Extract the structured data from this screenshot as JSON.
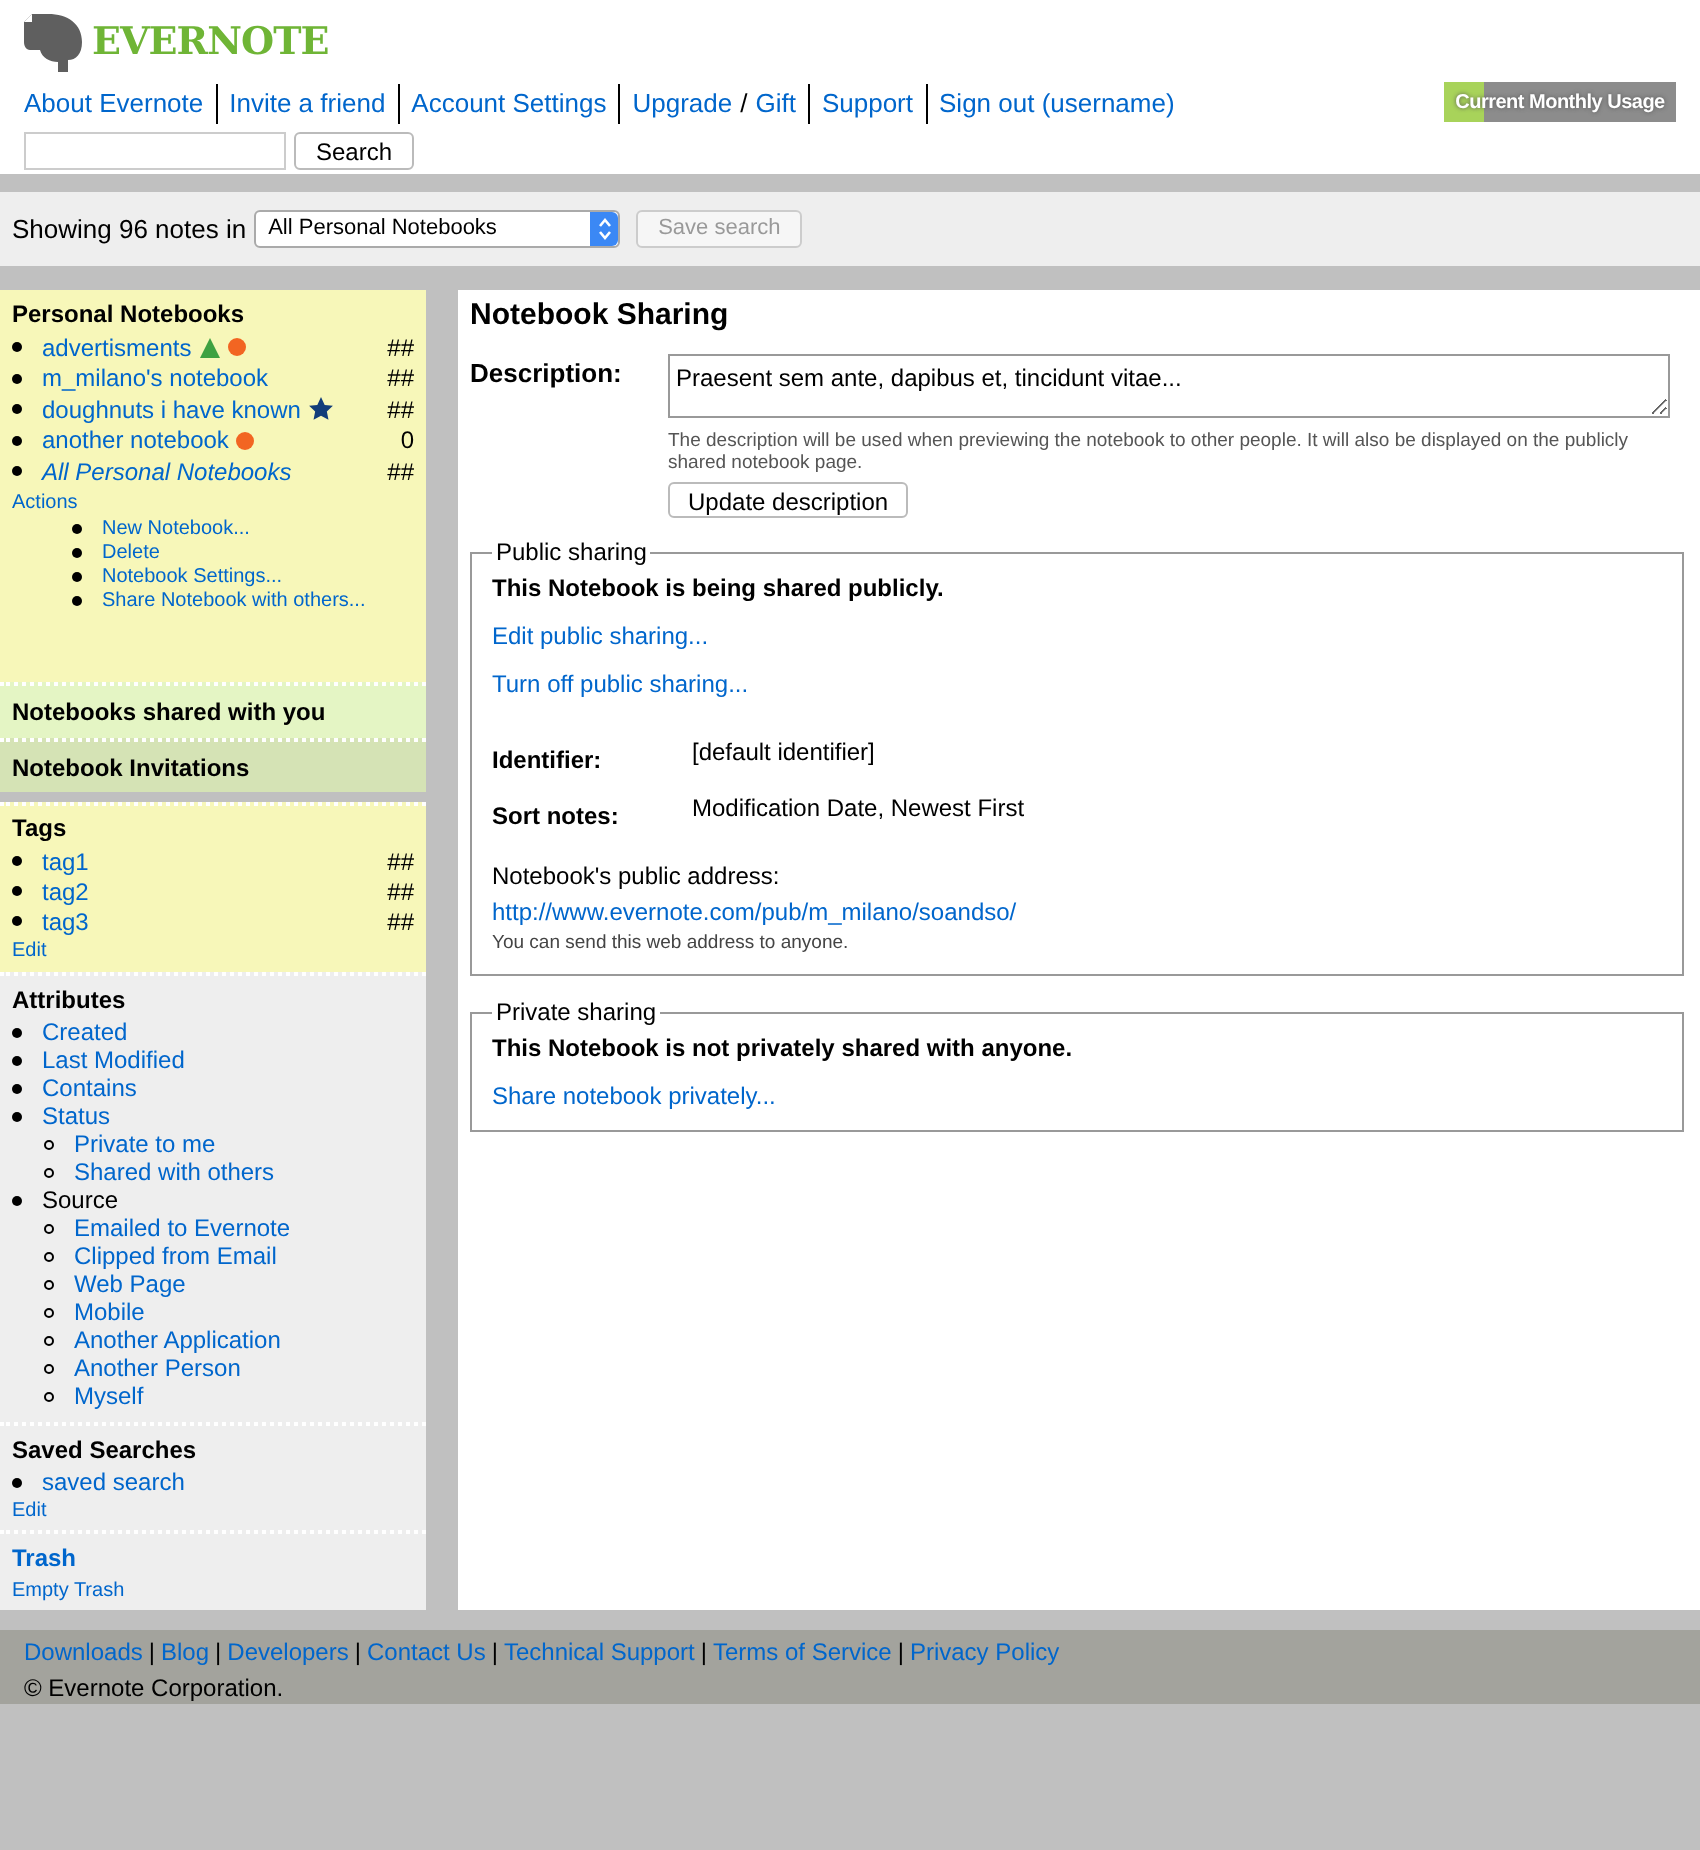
{
  "header": {
    "logo": "EVERNOTE",
    "nav": [
      "About Evernote",
      "Invite a friend",
      "Account Settings",
      "Upgrade",
      "Gift",
      "Support",
      "Sign out (username)"
    ],
    "upgrade_separator": "/",
    "search_button": "Search",
    "usage": {
      "label": "Current Monthly Usage",
      "level": 0.17
    }
  },
  "toolbar": {
    "showing": "Showing 96 notes in",
    "notebook_select": "All Personal Notebooks",
    "save_button": "Save search",
    "save_disabled": true
  },
  "sidebar": {
    "notebooks": {
      "title": "Personal Notebooks",
      "items": [
        {
          "name": "advertisments",
          "count": "##",
          "triangle": true,
          "dot": true,
          "star": false,
          "italic": false
        },
        {
          "name": "m_milano's notebook",
          "count": "##",
          "triangle": false,
          "dot": false,
          "star": false,
          "italic": false
        },
        {
          "name": "doughnuts i have known",
          "count": "##",
          "triangle": false,
          "dot": false,
          "star": true,
          "italic": false
        },
        {
          "name": "another notebook",
          "count": "0",
          "triangle": false,
          "dot": true,
          "star": false,
          "italic": false
        },
        {
          "name": "All Personal Notebooks",
          "count": "##",
          "triangle": false,
          "dot": false,
          "star": false,
          "italic": true
        }
      ],
      "actions_label": "Actions",
      "actions": [
        "New Notebook...",
        "Delete",
        "Notebook Settings...",
        "Share Notebook with others..."
      ]
    },
    "shared_title": "Notebooks shared with you",
    "invitations_title": "Notebook Invitations",
    "tags": {
      "title": "Tags",
      "items": [
        {
          "name": "tag1",
          "count": "##"
        },
        {
          "name": "tag2",
          "count": "##"
        },
        {
          "name": "tag3",
          "count": "##"
        }
      ],
      "edit": "Edit"
    },
    "attributes": {
      "title": "Attributes",
      "items": [
        {
          "label": "Created",
          "link": true
        },
        {
          "label": "Last Modified",
          "link": true
        },
        {
          "label": "Contains",
          "link": true
        },
        {
          "label": "Status",
          "link": true,
          "children": [
            {
              "label": "Private to me"
            },
            {
              "label": "Shared with others"
            }
          ]
        },
        {
          "label": "Source",
          "link": false,
          "children": [
            {
              "label": "Emailed to Evernote"
            },
            {
              "label": "Clipped from Email"
            },
            {
              "label": "Web Page"
            },
            {
              "label": "Mobile"
            },
            {
              "label": "Another Application"
            },
            {
              "label": "Another Person"
            },
            {
              "label": "Myself"
            }
          ]
        }
      ]
    },
    "saved_searches": {
      "title": "Saved Searches",
      "items": [
        "saved search"
      ],
      "edit": "Edit"
    },
    "trash": {
      "title": "Trash",
      "empty": "Empty Trash"
    }
  },
  "main": {
    "title": "Notebook Sharing",
    "description_label": "Description:",
    "description_value": "Praesent sem ante, dapibus et, tincidunt vitae...",
    "description_help": "The description will be used when previewing the notebook to other people. It will also be displayed on the publicly shared notebook page.",
    "update_button": "Update description",
    "public": {
      "legend": "Public sharing",
      "status": "This Notebook is being shared publicly.",
      "links": [
        "Edit public sharing...",
        "Turn off public sharing..."
      ],
      "fields": [
        {
          "label": "Identifier:",
          "value": "[default identifier]"
        },
        {
          "label": "Sort notes:",
          "value": "Modification Date, Newest First"
        }
      ],
      "address_label": "Notebook's public address:",
      "address": "http://www.evernote.com/pub/m_milano/soandso/",
      "address_note": "You can send this web address to anyone."
    },
    "private": {
      "legend": "Private sharing",
      "status": "This Notebook is not privately shared with anyone.",
      "link": "Share notebook privately..."
    }
  },
  "footer": {
    "links": [
      "Downloads",
      "Blog",
      "Developers",
      "Contact Us",
      "Technical Support",
      "Terms of Service",
      "Privacy Policy"
    ],
    "separator": "|",
    "copyright": "© Evernote Corporation."
  }
}
